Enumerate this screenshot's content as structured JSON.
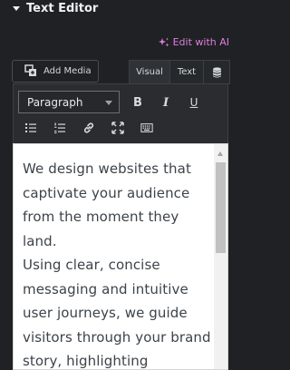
{
  "section": {
    "title": "Text Editor"
  },
  "ai": {
    "label": "Edit with AI",
    "color": "#e07de0"
  },
  "media": {
    "add_label": "Add Media"
  },
  "tabs": [
    {
      "label": "Visual",
      "active": true
    },
    {
      "label": "Text",
      "active": false
    }
  ],
  "toolbar": {
    "format_value": "Paragraph",
    "bold_label": "B",
    "italic_label": "I",
    "underline_label": "U"
  },
  "editor": {
    "paragraphs": [
      "We design websites that captivate your audience from the moment they land.",
      "Using clear, concise messaging and intuitive user journeys, we guide visitors through your brand story, highlighting"
    ]
  }
}
